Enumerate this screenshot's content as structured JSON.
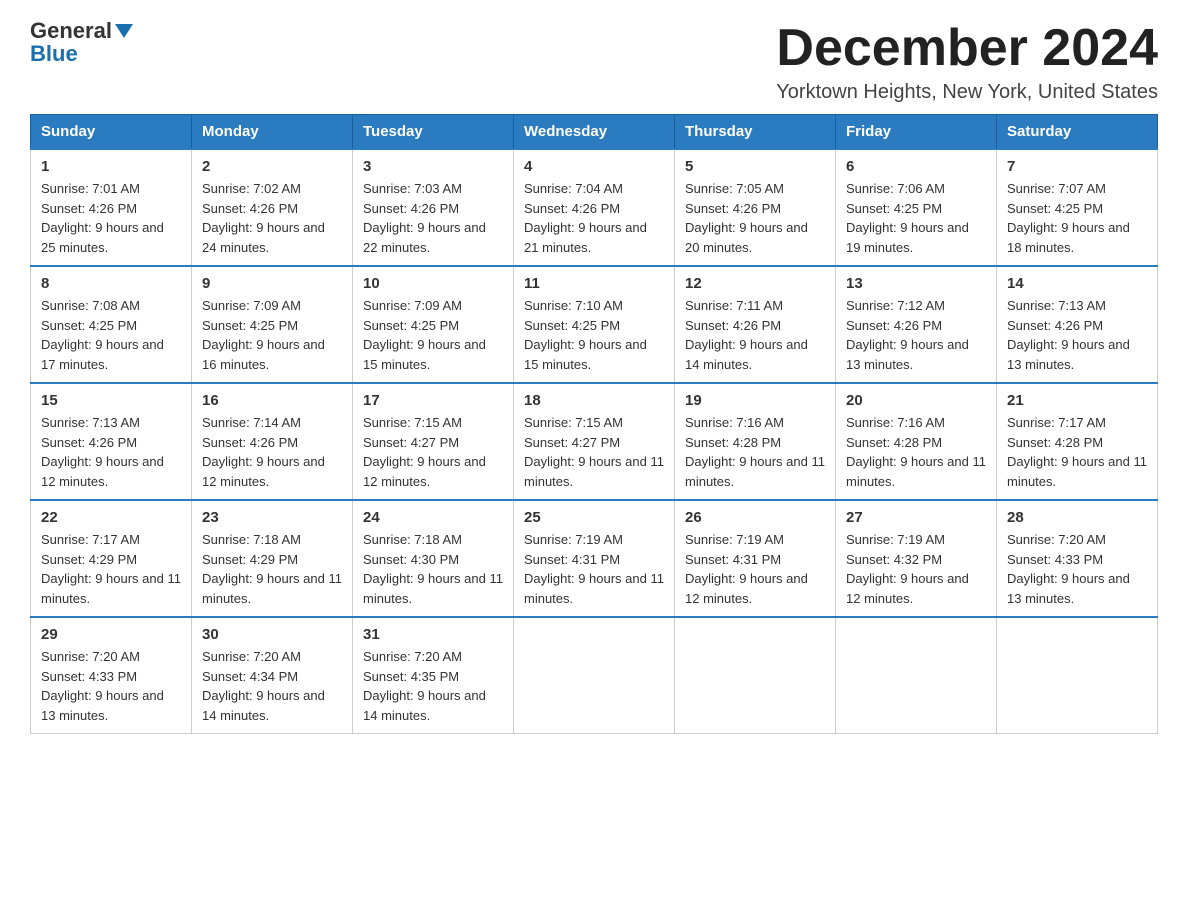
{
  "logo": {
    "general": "General",
    "blue": "Blue"
  },
  "title": "December 2024",
  "subtitle": "Yorktown Heights, New York, United States",
  "days_of_week": [
    "Sunday",
    "Monday",
    "Tuesday",
    "Wednesday",
    "Thursday",
    "Friday",
    "Saturday"
  ],
  "weeks": [
    [
      {
        "day": "1",
        "sunrise": "Sunrise: 7:01 AM",
        "sunset": "Sunset: 4:26 PM",
        "daylight": "Daylight: 9 hours and 25 minutes."
      },
      {
        "day": "2",
        "sunrise": "Sunrise: 7:02 AM",
        "sunset": "Sunset: 4:26 PM",
        "daylight": "Daylight: 9 hours and 24 minutes."
      },
      {
        "day": "3",
        "sunrise": "Sunrise: 7:03 AM",
        "sunset": "Sunset: 4:26 PM",
        "daylight": "Daylight: 9 hours and 22 minutes."
      },
      {
        "day": "4",
        "sunrise": "Sunrise: 7:04 AM",
        "sunset": "Sunset: 4:26 PM",
        "daylight": "Daylight: 9 hours and 21 minutes."
      },
      {
        "day": "5",
        "sunrise": "Sunrise: 7:05 AM",
        "sunset": "Sunset: 4:26 PM",
        "daylight": "Daylight: 9 hours and 20 minutes."
      },
      {
        "day": "6",
        "sunrise": "Sunrise: 7:06 AM",
        "sunset": "Sunset: 4:25 PM",
        "daylight": "Daylight: 9 hours and 19 minutes."
      },
      {
        "day": "7",
        "sunrise": "Sunrise: 7:07 AM",
        "sunset": "Sunset: 4:25 PM",
        "daylight": "Daylight: 9 hours and 18 minutes."
      }
    ],
    [
      {
        "day": "8",
        "sunrise": "Sunrise: 7:08 AM",
        "sunset": "Sunset: 4:25 PM",
        "daylight": "Daylight: 9 hours and 17 minutes."
      },
      {
        "day": "9",
        "sunrise": "Sunrise: 7:09 AM",
        "sunset": "Sunset: 4:25 PM",
        "daylight": "Daylight: 9 hours and 16 minutes."
      },
      {
        "day": "10",
        "sunrise": "Sunrise: 7:09 AM",
        "sunset": "Sunset: 4:25 PM",
        "daylight": "Daylight: 9 hours and 15 minutes."
      },
      {
        "day": "11",
        "sunrise": "Sunrise: 7:10 AM",
        "sunset": "Sunset: 4:25 PM",
        "daylight": "Daylight: 9 hours and 15 minutes."
      },
      {
        "day": "12",
        "sunrise": "Sunrise: 7:11 AM",
        "sunset": "Sunset: 4:26 PM",
        "daylight": "Daylight: 9 hours and 14 minutes."
      },
      {
        "day": "13",
        "sunrise": "Sunrise: 7:12 AM",
        "sunset": "Sunset: 4:26 PM",
        "daylight": "Daylight: 9 hours and 13 minutes."
      },
      {
        "day": "14",
        "sunrise": "Sunrise: 7:13 AM",
        "sunset": "Sunset: 4:26 PM",
        "daylight": "Daylight: 9 hours and 13 minutes."
      }
    ],
    [
      {
        "day": "15",
        "sunrise": "Sunrise: 7:13 AM",
        "sunset": "Sunset: 4:26 PM",
        "daylight": "Daylight: 9 hours and 12 minutes."
      },
      {
        "day": "16",
        "sunrise": "Sunrise: 7:14 AM",
        "sunset": "Sunset: 4:26 PM",
        "daylight": "Daylight: 9 hours and 12 minutes."
      },
      {
        "day": "17",
        "sunrise": "Sunrise: 7:15 AM",
        "sunset": "Sunset: 4:27 PM",
        "daylight": "Daylight: 9 hours and 12 minutes."
      },
      {
        "day": "18",
        "sunrise": "Sunrise: 7:15 AM",
        "sunset": "Sunset: 4:27 PM",
        "daylight": "Daylight: 9 hours and 11 minutes."
      },
      {
        "day": "19",
        "sunrise": "Sunrise: 7:16 AM",
        "sunset": "Sunset: 4:28 PM",
        "daylight": "Daylight: 9 hours and 11 minutes."
      },
      {
        "day": "20",
        "sunrise": "Sunrise: 7:16 AM",
        "sunset": "Sunset: 4:28 PM",
        "daylight": "Daylight: 9 hours and 11 minutes."
      },
      {
        "day": "21",
        "sunrise": "Sunrise: 7:17 AM",
        "sunset": "Sunset: 4:28 PM",
        "daylight": "Daylight: 9 hours and 11 minutes."
      }
    ],
    [
      {
        "day": "22",
        "sunrise": "Sunrise: 7:17 AM",
        "sunset": "Sunset: 4:29 PM",
        "daylight": "Daylight: 9 hours and 11 minutes."
      },
      {
        "day": "23",
        "sunrise": "Sunrise: 7:18 AM",
        "sunset": "Sunset: 4:29 PM",
        "daylight": "Daylight: 9 hours and 11 minutes."
      },
      {
        "day": "24",
        "sunrise": "Sunrise: 7:18 AM",
        "sunset": "Sunset: 4:30 PM",
        "daylight": "Daylight: 9 hours and 11 minutes."
      },
      {
        "day": "25",
        "sunrise": "Sunrise: 7:19 AM",
        "sunset": "Sunset: 4:31 PM",
        "daylight": "Daylight: 9 hours and 11 minutes."
      },
      {
        "day": "26",
        "sunrise": "Sunrise: 7:19 AM",
        "sunset": "Sunset: 4:31 PM",
        "daylight": "Daylight: 9 hours and 12 minutes."
      },
      {
        "day": "27",
        "sunrise": "Sunrise: 7:19 AM",
        "sunset": "Sunset: 4:32 PM",
        "daylight": "Daylight: 9 hours and 12 minutes."
      },
      {
        "day": "28",
        "sunrise": "Sunrise: 7:20 AM",
        "sunset": "Sunset: 4:33 PM",
        "daylight": "Daylight: 9 hours and 13 minutes."
      }
    ],
    [
      {
        "day": "29",
        "sunrise": "Sunrise: 7:20 AM",
        "sunset": "Sunset: 4:33 PM",
        "daylight": "Daylight: 9 hours and 13 minutes."
      },
      {
        "day": "30",
        "sunrise": "Sunrise: 7:20 AM",
        "sunset": "Sunset: 4:34 PM",
        "daylight": "Daylight: 9 hours and 14 minutes."
      },
      {
        "day": "31",
        "sunrise": "Sunrise: 7:20 AM",
        "sunset": "Sunset: 4:35 PM",
        "daylight": "Daylight: 9 hours and 14 minutes."
      },
      null,
      null,
      null,
      null
    ]
  ]
}
